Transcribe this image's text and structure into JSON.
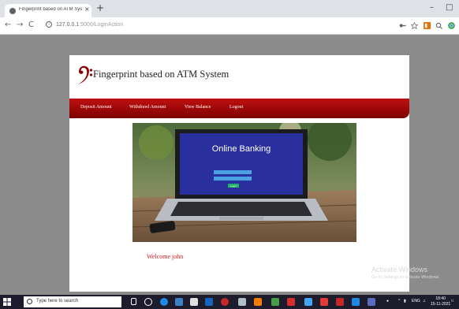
{
  "browser": {
    "tab_title": "Fingerprint based on ATM Syste",
    "tab_close": "×",
    "new_tab": "+",
    "minimize": "–",
    "restore": "□",
    "url_host": "127.0.0.1",
    "url_path": ":5000/LoginAction"
  },
  "site": {
    "title": "Fingerprint based on ATM System",
    "menu": [
      {
        "label": "Deposit Amount"
      },
      {
        "label": "Withdrawl Amount"
      },
      {
        "label": "View Balance"
      },
      {
        "label": "Logout"
      }
    ],
    "hero": {
      "screen_text": "Online Banking",
      "button_text": "Login"
    },
    "welcome": "Welcome john"
  },
  "watermark": {
    "line1": "Activate Windows",
    "line2": "Go to Settings to activate Windows."
  },
  "taskbar": {
    "search_placeholder": "Type here to search",
    "time": "18:40",
    "date": "15-11-2021",
    "lang": "ENG"
  },
  "colors": {
    "menu_red": "#a30000",
    "welcome_red": "#e02020",
    "page_gray": "#8b8b8b"
  }
}
